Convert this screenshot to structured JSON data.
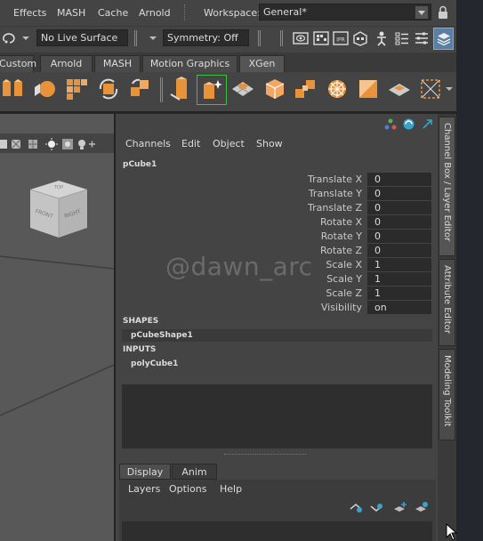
{
  "menubar": {
    "items": [
      "Effects",
      "MASH",
      "Cache",
      "Arnold"
    ],
    "workspace_label": "Workspace:",
    "workspace_value": "General*"
  },
  "statusline": {
    "live_surface": "No Live Surface",
    "symmetry": "Symmetry: Off"
  },
  "shelf": {
    "tabs": [
      "Custom",
      "Arnold",
      "MASH",
      "Motion Graphics",
      "XGen"
    ],
    "active_tab": "XGen"
  },
  "channel_box": {
    "menus": [
      "Channels",
      "Edit",
      "Object",
      "Show"
    ],
    "object_name": "pCube1",
    "attributes": [
      {
        "label": "Translate X",
        "value": "0"
      },
      {
        "label": "Translate Y",
        "value": "0"
      },
      {
        "label": "Translate Z",
        "value": "0"
      },
      {
        "label": "Rotate X",
        "value": "0"
      },
      {
        "label": "Rotate Y",
        "value": "0"
      },
      {
        "label": "Rotate Z",
        "value": "0"
      },
      {
        "label": "Scale X",
        "value": "1"
      },
      {
        "label": "Scale Y",
        "value": "1"
      },
      {
        "label": "Scale Z",
        "value": "1"
      },
      {
        "label": "Visibility",
        "value": "on"
      }
    ],
    "shapes_header": "SHAPES",
    "shape_node": "pCubeShape1",
    "inputs_header": "INPUTS",
    "input_node": "polyCube1"
  },
  "layer_editor": {
    "tabs": [
      "Display",
      "Anim"
    ],
    "menus": [
      "Layers",
      "Options",
      "Help"
    ]
  },
  "right_tabs": [
    "Channel Box / Layer Editor",
    "Attribute Editor",
    "Modeling Toolkit"
  ],
  "viewcube": {
    "front": "FRONT",
    "right": "RIGHT",
    "top": "TOP"
  },
  "watermark": "@dawn_arc",
  "colors": {
    "accent_orange": "#e8923a",
    "selection_green": "#39c33f",
    "panel_bg": "#444444"
  }
}
